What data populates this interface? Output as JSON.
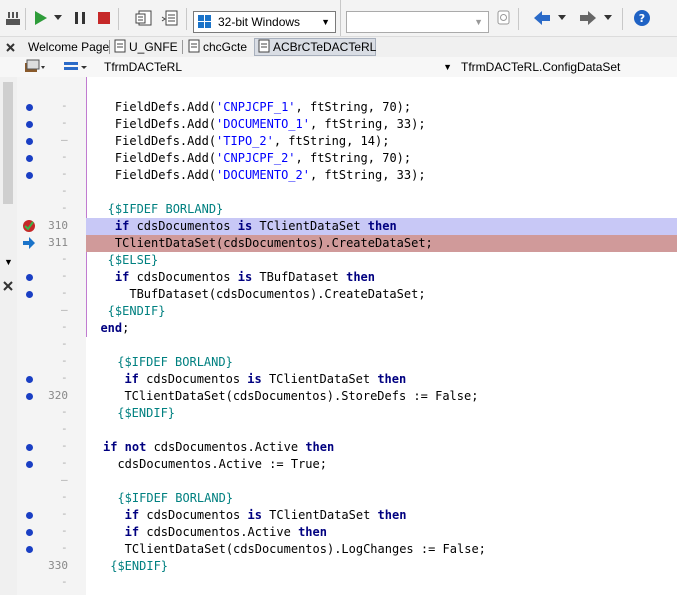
{
  "toolbar": {
    "platform": "32-bit Windows",
    "config_value": ""
  },
  "tabs": [
    {
      "label": "Welcome Page"
    },
    {
      "label": "U_GNFE"
    },
    {
      "label": "chcGcte"
    },
    {
      "label": "ACBrCTeDACTeRL"
    }
  ],
  "navbar": {
    "class_combo": "TfrmDACTeRL",
    "method_combo": "TfrmDACTeRL.ConfigDataSet"
  },
  "gutter": {
    "line_310": "310",
    "line_311": "311",
    "line_320": "320",
    "line_330": "330"
  },
  "code": {
    "l1_pre": "    FieldDefs.Add(",
    "l1_str": "'CNPJCPF_1'",
    "l1_post": ", ftString, 70);",
    "l2_pre": "    FieldDefs.Add(",
    "l2_str": "'DOCUMENTO_1'",
    "l2_post": ", ftString, 33);",
    "l3_pre": "    FieldDefs.Add(",
    "l3_str": "'TIPO_2'",
    "l3_post": ", ftString, 14);",
    "l4_pre": "    FieldDefs.Add(",
    "l4_str": "'CNPJCPF_2'",
    "l4_post": ", ftString, 70);",
    "l5_pre": "    FieldDefs.Add(",
    "l5_str": "'DOCUMENTO_2'",
    "l5_post": ", ftString, 33);",
    "l6_dir": "   {$IFDEF BORLAND}",
    "l7_kw1": "    if",
    "l7_mid": " cdsDocumentos ",
    "l7_kw2": "is",
    "l7_mid2": " TClientDataSet ",
    "l7_kw3": "then",
    "l8_text": "    TClientDataSet(cdsDocumentos).CreateDataSet;",
    "l9_dir": "   {$ELSE}",
    "l10_kw1": "    if",
    "l10_mid": " cdsDocumentos ",
    "l10_kw2": "is",
    "l10_mid2": " TBufDataset ",
    "l10_kw3": "then",
    "l11_text": "      TBufDataset(cdsDocumentos).CreateDataSet;",
    "l12_dir": "   {$ENDIF}",
    "l13_kw": "  end",
    "l13_post": ";",
    "l14_dir": " {$IFDEF BORLAND}",
    "l15_kw1": "  if",
    "l15_mid": " cdsDocumentos ",
    "l15_kw2": "is",
    "l15_mid2": " TClientDataSet ",
    "l15_kw3": "then",
    "l16_text": "  TClientDataSet(cdsDocumentos).StoreDefs := False;",
    "l17_dir": " {$ENDIF}",
    "l18_kw1": "if",
    "l18_kw2": " not",
    "l18_mid": " cdsDocumentos.Active ",
    "l18_kw3": "then",
    "l19_text": "  cdsDocumentos.Active := True;",
    "l20_dir": "  {$IFDEF BORLAND}",
    "l21_kw1": "   if",
    "l21_mid": " cdsDocumentos ",
    "l21_kw2": "is",
    "l21_mid2": " TClientDataSet ",
    "l21_kw3": "then",
    "l22_kw1": "   if",
    "l22_mid": " cdsDocumentos.Active ",
    "l22_kw2": "then",
    "l23_text": "   TClientDataSet(cdsDocumentos).LogChanges := False;",
    "l24_dir": " {$ENDIF}"
  },
  "colors": {
    "breakpoint_highlight": "#c8c8f6",
    "execution_highlight": "#d09a9a",
    "directive": "#008080",
    "string": "#0000ff",
    "keyword": "#000080"
  }
}
